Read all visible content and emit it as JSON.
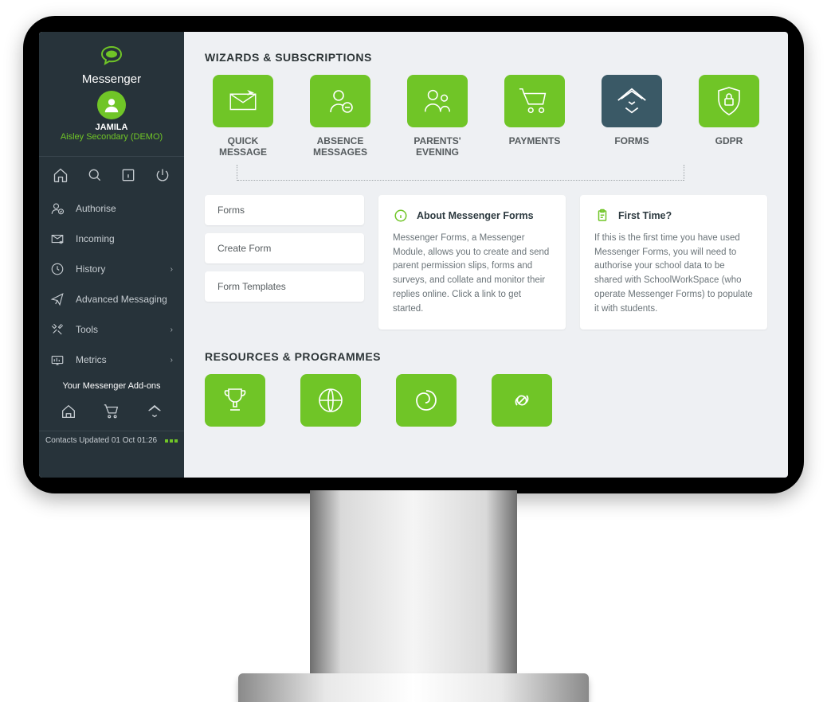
{
  "brand": "Messenger",
  "user": {
    "name": "JAMILA",
    "school": "Aisley Secondary (DEMO)"
  },
  "nav": {
    "authorise": "Authorise",
    "incoming": "Incoming",
    "history": "History",
    "advanced": "Advanced Messaging",
    "tools": "Tools",
    "metrics": "Metrics"
  },
  "addons_title": "Your Messenger Add-ons",
  "status_text": "Contacts Updated 01 Oct 01:26",
  "sections": {
    "wizards": "WIZARDS & SUBSCRIPTIONS",
    "resources": "RESOURCES & PROGRAMMES"
  },
  "wizards": {
    "quick": "QUICK\nMESSAGE",
    "absence": "ABSENCE\nMESSAGES",
    "parents": "PARENTS'\nEVENING",
    "payments": "PAYMENTS",
    "forms": "FORMS",
    "gdpr": "GDPR"
  },
  "forms_links": {
    "forms": "Forms",
    "create": "Create Form",
    "templates": "Form Templates"
  },
  "about": {
    "title": "About Messenger Forms",
    "body": "Messenger Forms, a Messenger Module, allows you to create and send parent permission slips, forms and surveys, and collate and monitor their replies online. Click a link to get started."
  },
  "first": {
    "title": "First Time?",
    "body": "If this is the first time you have used Messenger Forms, you will need to authorise your school data to be shared with SchoolWorkSpace (who operate Messenger Forms) to populate it with students."
  }
}
